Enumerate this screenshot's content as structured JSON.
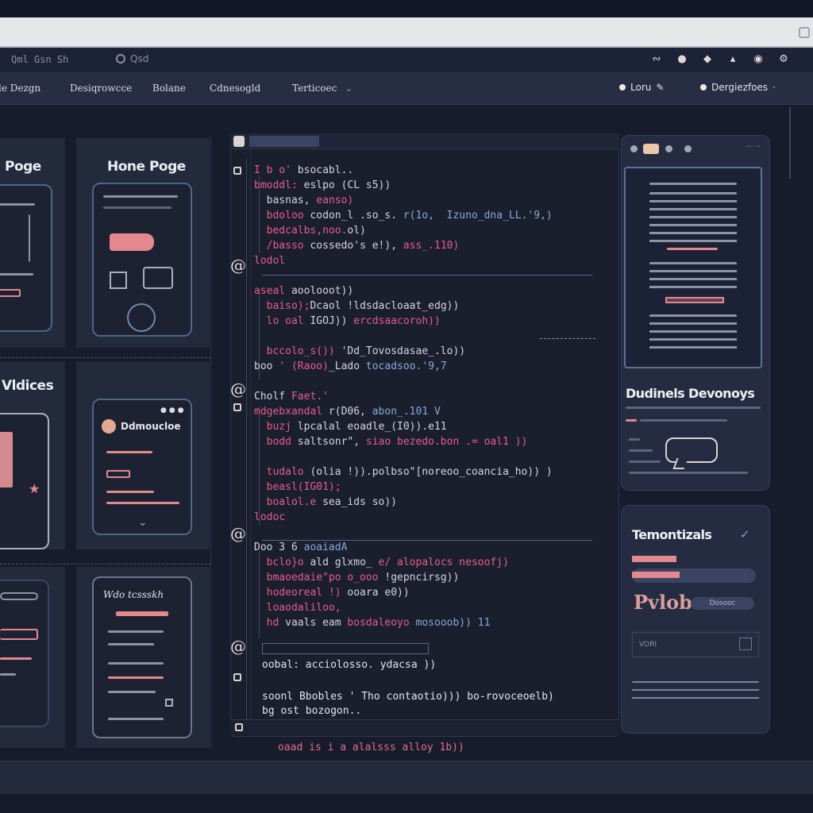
{
  "app": {
    "title": "Qml Gsn Sh",
    "status": "Qsd"
  },
  "nav": {
    "items": [
      "le Dezgn",
      "Desiqrowcce",
      "Bolane",
      "Cdnesogld",
      "Terticoec"
    ],
    "right": [
      "Loru",
      "Dergiezfoes"
    ]
  },
  "gallery": {
    "card1_title": "Poge",
    "card2_title": "Hone Poge",
    "card3_title": "Vldices",
    "card4_label": "Ddmoucloe",
    "card6_label": "Wdo tcssskh"
  },
  "code": {
    "lines": [
      [
        {
          "t": "I b o' ",
          "c": "k"
        },
        {
          "t": "bsocabl..",
          "c": "f"
        }
      ],
      [
        {
          "t": "bmoddl: ",
          "c": "k"
        },
        {
          "t": "eslpo (CL s5))",
          "c": "f"
        }
      ],
      [
        {
          "t": "  basnas, ",
          "c": "f"
        },
        {
          "t": "eanso)",
          "c": "k"
        }
      ],
      [
        {
          "t": "  bdoloo ",
          "c": "k"
        },
        {
          "t": "codon_l .so_s. ",
          "c": "f"
        },
        {
          "t": "r(1o,  Izuno_dna_LL.'9,)",
          "c": "c"
        }
      ],
      [
        {
          "t": "  bedcalbs,noo.",
          "c": "k"
        },
        {
          "t": "ol)",
          "c": "f"
        }
      ],
      [
        {
          "t": "  /basso ",
          "c": "k"
        },
        {
          "t": "cossedo's e!), ",
          "c": "f"
        },
        {
          "t": "ass_.110)",
          "c": "k"
        }
      ],
      [
        {
          "t": "lodol",
          "c": "k"
        }
      ],
      [],
      [
        {
          "t": "aseal ",
          "c": "k"
        },
        {
          "t": "aoolooot))",
          "c": "f"
        }
      ],
      [
        {
          "t": "  baiso);",
          "c": "k"
        },
        {
          "t": "Dcaol !ldsdacloaat_edg))",
          "c": "f"
        }
      ],
      [
        {
          "t": "  lo oal ",
          "c": "k"
        },
        {
          "t": "IGOJ)) ",
          "c": "f"
        },
        {
          "t": "ercdsaacoroh))",
          "c": "k"
        }
      ],
      [],
      [
        {
          "t": "  bccolo_s()) ",
          "c": "k"
        },
        {
          "t": "'Dd_Tovosdasae_.lo))",
          "c": "f"
        }
      ],
      [
        {
          "t": "boo ",
          "c": "f"
        },
        {
          "t": "' (Raoo)",
          "c": "k"
        },
        {
          "t": "_Lado ",
          "c": "f"
        },
        {
          "t": "tocadsoo.'9,7",
          "c": "c"
        }
      ],
      [],
      [
        {
          "t": "Cholf ",
          "c": "f"
        },
        {
          "t": "Faet.'",
          "c": "k"
        }
      ],
      [
        {
          "t": "mdgebxandal ",
          "c": "k"
        },
        {
          "t": "r(D06, ",
          "c": "f"
        },
        {
          "t": "abon_.101 V",
          "c": "c"
        }
      ],
      [
        {
          "t": "  buzj ",
          "c": "k"
        },
        {
          "t": "lpcalal eoadle_(I0)).e11",
          "c": "f"
        }
      ],
      [
        {
          "t": "  bodd ",
          "c": "k"
        },
        {
          "t": "saltsonr\", ",
          "c": "f"
        },
        {
          "t": "siao bezedo.bon .= oal1 ))",
          "c": "k"
        }
      ],
      [],
      [
        {
          "t": "  tudalo ",
          "c": "k"
        },
        {
          "t": "(olia !)).polbso\"[noreoo_coancia_ho)) )",
          "c": "f"
        }
      ],
      [
        {
          "t": "  beasl(IG01);",
          "c": "k"
        }
      ],
      [
        {
          "t": "  boalol.e ",
          "c": "k"
        },
        {
          "t": "sea_ids so))",
          "c": "f"
        }
      ],
      [
        {
          "t": "lodoc",
          "c": "k"
        }
      ],
      [],
      [
        {
          "t": "Doo 3 6 ",
          "c": "f"
        },
        {
          "t": "aoaiadA",
          "c": "c"
        }
      ],
      [
        {
          "t": "  bclo}o ",
          "c": "k"
        },
        {
          "t": "ald glxmo_ ",
          "c": "f"
        },
        {
          "t": "e/ alopalocs nesoofj)",
          "c": "k"
        }
      ],
      [
        {
          "t": "  bmaoedaie\"po o_ooo ",
          "c": "k"
        },
        {
          "t": "!gepncirsg))",
          "c": "f"
        }
      ],
      [
        {
          "t": "  hodeoreal !) ",
          "c": "k"
        },
        {
          "t": "ooara e0))",
          "c": "f"
        }
      ],
      [
        {
          "t": "  loaodaliloo,",
          "c": "k"
        }
      ],
      [
        {
          "t": "  hd ",
          "c": "k"
        },
        {
          "t": "vaals eam ",
          "c": "f"
        },
        {
          "t": "bosdaleoyo ",
          "c": "k"
        },
        {
          "t": "mosooob)) 11",
          "c": "c"
        }
      ]
    ],
    "tail1": "oobal: acciolosso. ydacsa ))",
    "tail2": "soonl Bbobles ' Tho contaotio))) bo-rovoceoelb)",
    "tail3": "bg ost bozogon..",
    "tail4": "oaad is i a alalsss alloy 1b))"
  },
  "right": {
    "title1": "Dudinels Devonoys",
    "title2": "Temontizals",
    "big": "Pvlob",
    "label_small": "Dosooc",
    "input": "VORI"
  },
  "colors": {
    "accent_pink": "#e85c8a",
    "accent_blue": "#8aa8d8",
    "bg": "#161c2c"
  }
}
